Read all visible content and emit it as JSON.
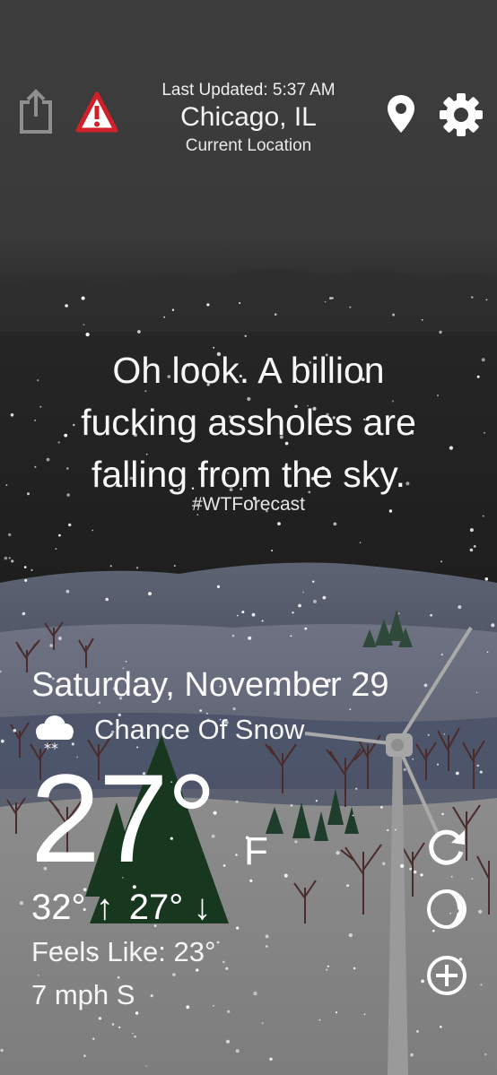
{
  "header": {
    "last_updated": "Last Updated: 5:37 AM",
    "city": "Chicago, IL",
    "location_label": "Current Location",
    "icons": [
      "share-icon",
      "alert-icon",
      "location-pin-icon",
      "gear-icon"
    ]
  },
  "quote": {
    "line1": "Oh look. A billion",
    "line2": "fucking assholes are",
    "line3": "falling from the sky.",
    "hashtag": "#WTForecast"
  },
  "forecast": {
    "date": "Saturday, November 29",
    "condition": "Chance Of Snow",
    "condition_icon": "snow-cloud-icon",
    "temperature": "27°",
    "unit": "F",
    "high": "32°",
    "high_arrow": "↑",
    "low": "27°",
    "low_arrow": "↓",
    "feels_like": "Feels Like: 23°",
    "wind": "7 mph S"
  },
  "side_actions": [
    "refresh-icon",
    "moon-phase-icon",
    "add-icon"
  ],
  "colors": {
    "sky_top": "#3b3b3b",
    "sky_mid": "#1f1f1f",
    "ground": "#8a8a8a",
    "alert_red": "#d0202a",
    "tree_green": "#1f3a24"
  }
}
